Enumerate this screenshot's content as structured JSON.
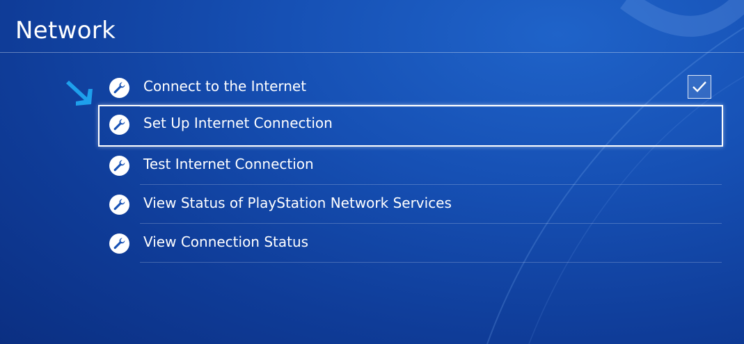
{
  "page": {
    "title": "Network"
  },
  "menu": {
    "items": [
      {
        "label": "Connect to the Internet",
        "icon": "wrench-icon",
        "checked": true
      },
      {
        "label": "Set Up Internet Connection",
        "icon": "wrench-icon",
        "selected": true
      },
      {
        "label": "Test Internet Connection",
        "icon": "wrench-icon"
      },
      {
        "label": "View Status of PlayStation Network Services",
        "icon": "wrench-icon"
      },
      {
        "label": "View Connection Status",
        "icon": "wrench-icon"
      }
    ]
  },
  "colors": {
    "background": "#1650b4",
    "accent_arrow": "#1ea0ec",
    "text": "#ffffff"
  }
}
